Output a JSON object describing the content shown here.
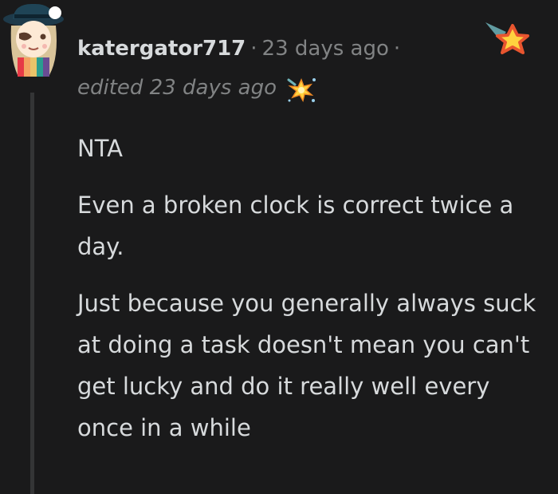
{
  "comment": {
    "username": "katergator717",
    "timestamp": "23 days ago",
    "separator": "·",
    "edited": "edited 23 days ago",
    "paragraphs": [
      "NTA",
      "Even a broken clock is correct twice a day.",
      "Just because you generally always suck at doing a task doesn't mean you can't get lucky and do it really well every once in a while"
    ]
  },
  "icons": {
    "avatar": "user-avatar",
    "edited": "sparkle-burst-icon",
    "award": "shooting-star-award-icon"
  },
  "colors": {
    "background": "#1a1a1b",
    "text": "#d7dadc",
    "muted": "#818384",
    "thread_line": "#343536",
    "star": "#f7a23b"
  }
}
